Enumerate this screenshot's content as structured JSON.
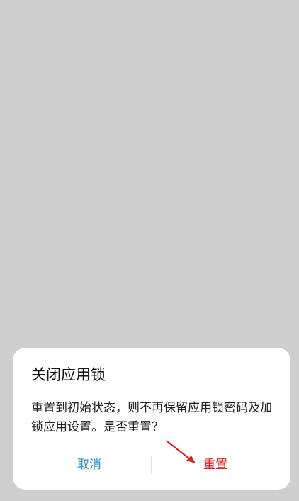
{
  "dialog": {
    "title": "关闭应用锁",
    "message": "重置到初始状态，则不再保留应用锁密码及加锁应用设置。是否重置？",
    "cancel_label": "取消",
    "confirm_label": "重置"
  },
  "colors": {
    "scrim": "#cfcfcf",
    "dialog_background": "#ffffff",
    "cancel_text": "#2a8ee0",
    "confirm_text": "#e02020",
    "annotation_arrow": "#e02020"
  },
  "icons": {
    "annotation": "arrow-pointer-icon"
  }
}
